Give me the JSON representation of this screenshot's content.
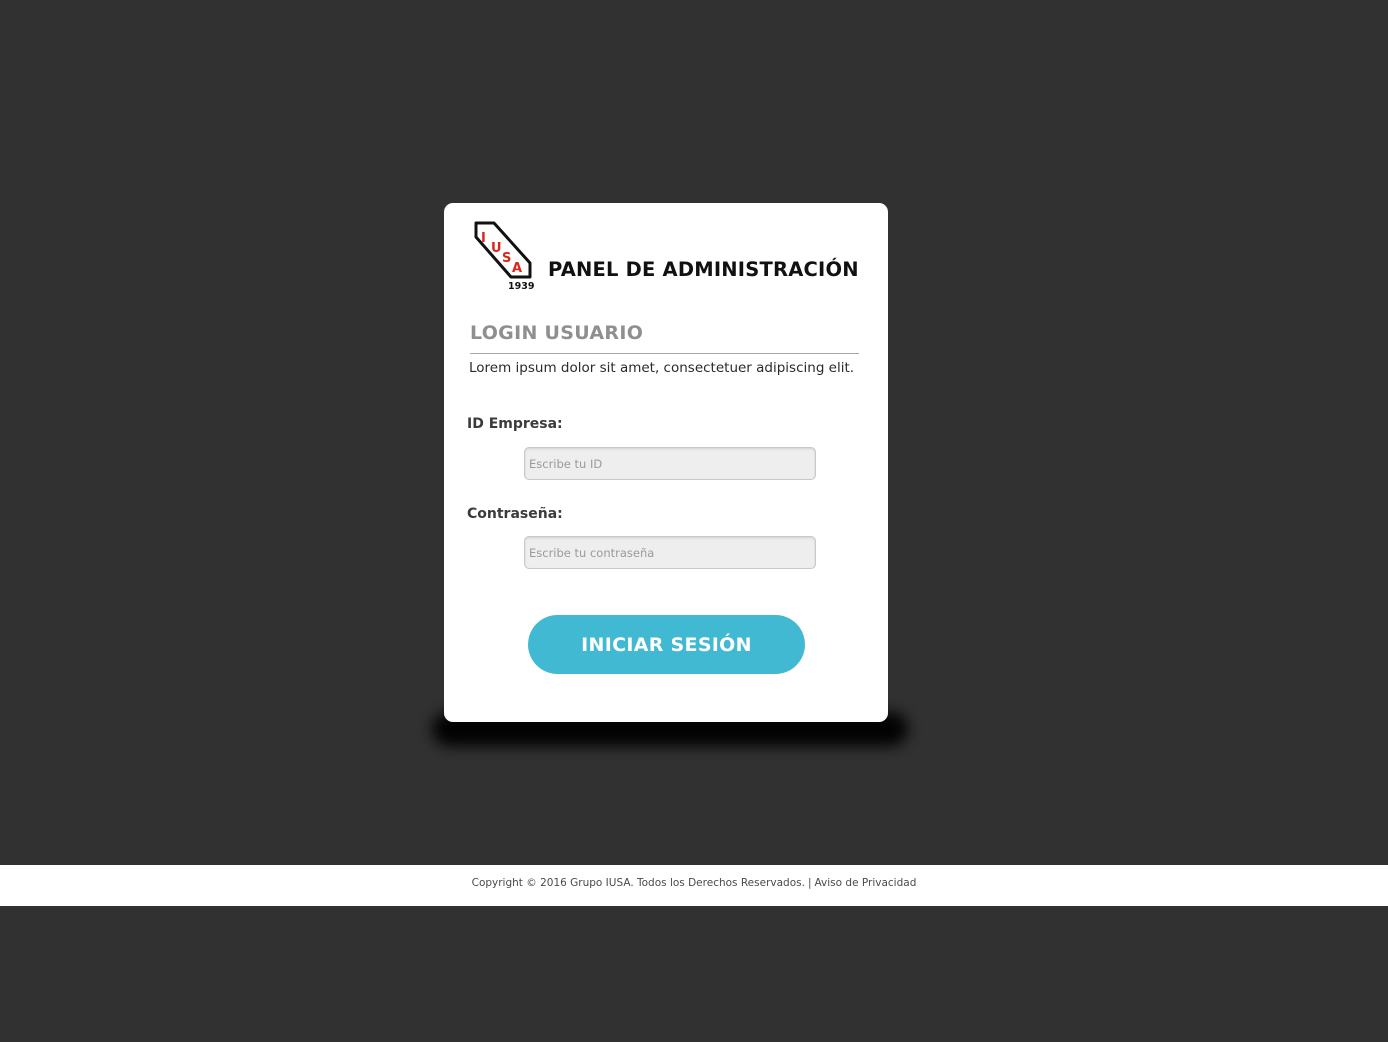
{
  "colors": {
    "background": "#313131",
    "card": "#ffffff",
    "accent_button": "#41b9d2",
    "logo_red": "#d9261c",
    "footer_bg": "#ffffff"
  },
  "logo": {
    "letters": [
      "I",
      "U",
      "S",
      "A"
    ],
    "year": "1939"
  },
  "header": {
    "title": "PANEL DE ADMINISTRACIÓN"
  },
  "login": {
    "title": "LOGIN USUARIO",
    "intro": "Lorem ipsum dolor sit amet, consectetuer adipiscing elit.",
    "id_field": {
      "label": "ID Empresa:",
      "placeholder": "Escribe tu ID",
      "value": ""
    },
    "password_field": {
      "label": "Contraseña:",
      "placeholder": "Escribe tu contraseña",
      "value": ""
    },
    "submit_label": "INICIAR SESIÓN"
  },
  "footer": {
    "copyright": "Copyright © 2016 Grupo IUSA. Todos los Derechos Reservados.",
    "separator": "|",
    "privacy_link": "Aviso de Privacidad"
  }
}
